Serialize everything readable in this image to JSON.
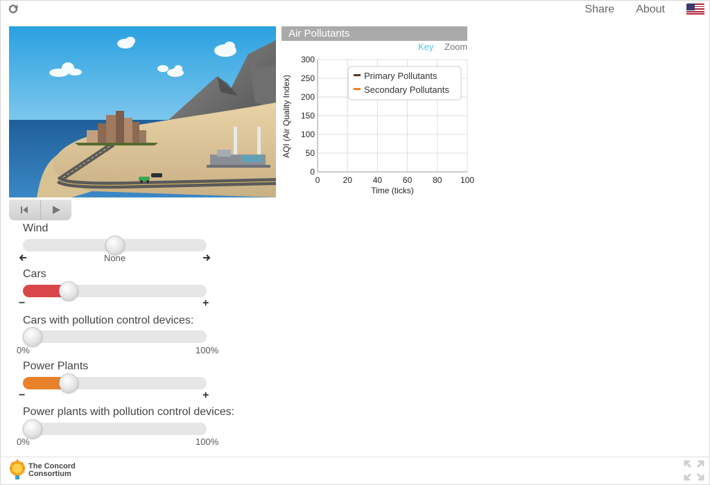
{
  "topbar": {
    "reload_icon": "reload-icon",
    "share_label": "Share",
    "about_label": "About",
    "language_icon": "us-flag-icon"
  },
  "playback": {
    "rewind_icon": "reset-icon",
    "play_icon": "play-icon"
  },
  "controls": {
    "wind": {
      "label": "Wind",
      "value_label": "None",
      "left_icon": "arrow-left-icon",
      "right_icon": "arrow-right-icon",
      "level": 0.5
    },
    "cars": {
      "label": "Cars",
      "minus": "−",
      "plus": "+",
      "level": 0.22,
      "color": "#d9474a"
    },
    "cars_devices": {
      "label": "Cars with pollution control devices:",
      "min_label": "0%",
      "max_label": "100%",
      "level": 0.0
    },
    "power_plants": {
      "label": "Power Plants",
      "minus": "−",
      "plus": "+",
      "level": 0.22,
      "color": "#e8822a"
    },
    "plants_devices": {
      "label": "Power plants with pollution control devices:",
      "min_label": "0%",
      "max_label": "100%",
      "level": 0.0
    }
  },
  "chart": {
    "title": "Air Pollutants",
    "key_label": "Key",
    "zoom_label": "Zoom",
    "key_color": "#4fc3e8"
  },
  "chart_data": {
    "type": "line",
    "title": "Air Pollutants",
    "xlabel": "Time (ticks)",
    "ylabel": "AQI (Air Quality Index)",
    "xlim": [
      0,
      100
    ],
    "ylim": [
      0,
      300
    ],
    "x_ticks": [
      "0",
      "20",
      "40",
      "60",
      "80",
      "100"
    ],
    "y_ticks": [
      "0",
      "50",
      "100",
      "150",
      "200",
      "250",
      "300"
    ],
    "grid": true,
    "legend_position": "top-right",
    "series": [
      {
        "name": "Primary Pollutants",
        "color": "#5a3a22",
        "x": [],
        "y": []
      },
      {
        "name": "Secondary Pollutants",
        "color": "#f07f1e",
        "x": [],
        "y": []
      }
    ]
  },
  "footer": {
    "logo_line1": "The Concord",
    "logo_line2": "Consortium",
    "fullscreen_icon": "fullscreen-icon"
  }
}
